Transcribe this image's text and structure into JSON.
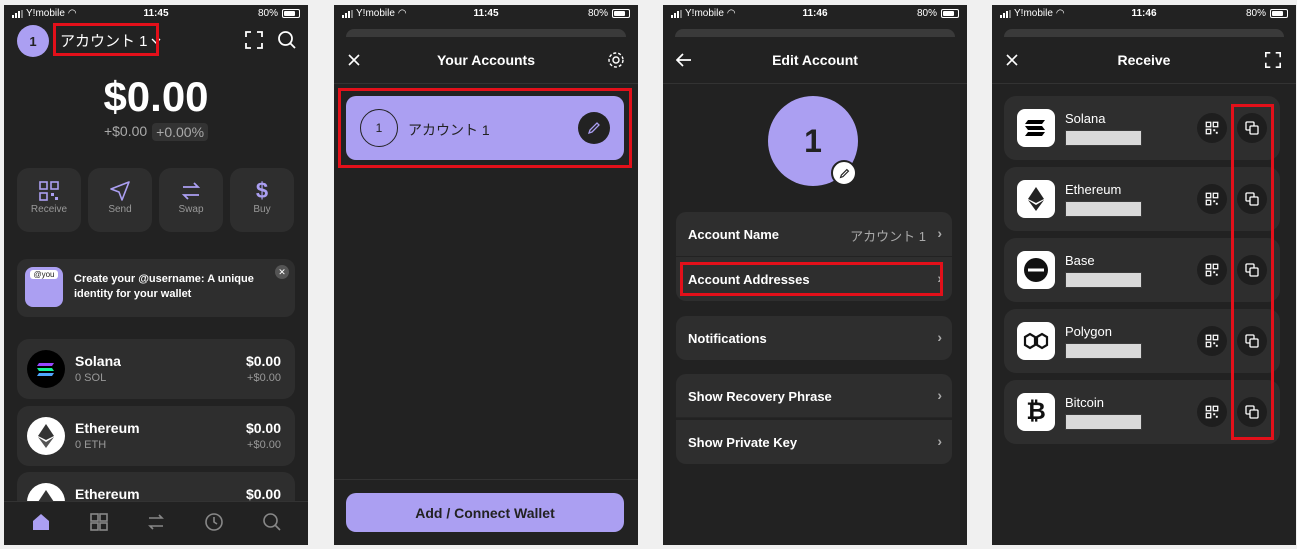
{
  "status_bar": [
    {
      "carrier": "Y!mobile",
      "time": "11:45",
      "battery": "80%"
    },
    {
      "carrier": "Y!mobile",
      "time": "11:45",
      "battery": "80%"
    },
    {
      "carrier": "Y!mobile",
      "time": "11:46",
      "battery": "80%"
    },
    {
      "carrier": "Y!mobile",
      "time": "11:46",
      "battery": "80%"
    }
  ],
  "home": {
    "avatar_number": "1",
    "account_name": "アカウント 1",
    "balance": "$0.00",
    "change_amount": "+$0.00",
    "change_percent": "+0.00%",
    "actions": [
      {
        "label": "Receive"
      },
      {
        "label": "Send"
      },
      {
        "label": "Swap"
      },
      {
        "label": "Buy"
      }
    ],
    "banner": {
      "badge": "@you",
      "text": "Create your @username: A unique identity for your wallet"
    },
    "tokens": [
      {
        "name": "Solana",
        "amount": "0 SOL",
        "value": "$0.00",
        "change": "+$0.00"
      },
      {
        "name": "Ethereum",
        "amount": "0 ETH",
        "value": "$0.00",
        "change": "+$0.00"
      },
      {
        "name": "Ethereum",
        "amount": "",
        "value": "$0.00",
        "change": ""
      }
    ]
  },
  "accounts": {
    "title": "Your Accounts",
    "items": [
      {
        "number": "1",
        "name": "アカウント 1"
      }
    ],
    "add_button": "Add / Connect Wallet"
  },
  "edit_account": {
    "title": "Edit Account",
    "avatar_number": "1",
    "account_name_label": "Account Name",
    "account_name_value": "アカウント 1",
    "account_addresses_label": "Account Addresses",
    "notifications_label": "Notifications",
    "recovery_label": "Show Recovery Phrase",
    "private_key_label": "Show Private Key"
  },
  "receive": {
    "title": "Receive",
    "chains": [
      {
        "name": "Solana"
      },
      {
        "name": "Ethereum"
      },
      {
        "name": "Base"
      },
      {
        "name": "Polygon"
      },
      {
        "name": "Bitcoin"
      }
    ]
  },
  "colors": {
    "accent": "#ab9ff2",
    "background": "#222222",
    "card": "#2e2e2e",
    "highlight": "#e3101a"
  }
}
